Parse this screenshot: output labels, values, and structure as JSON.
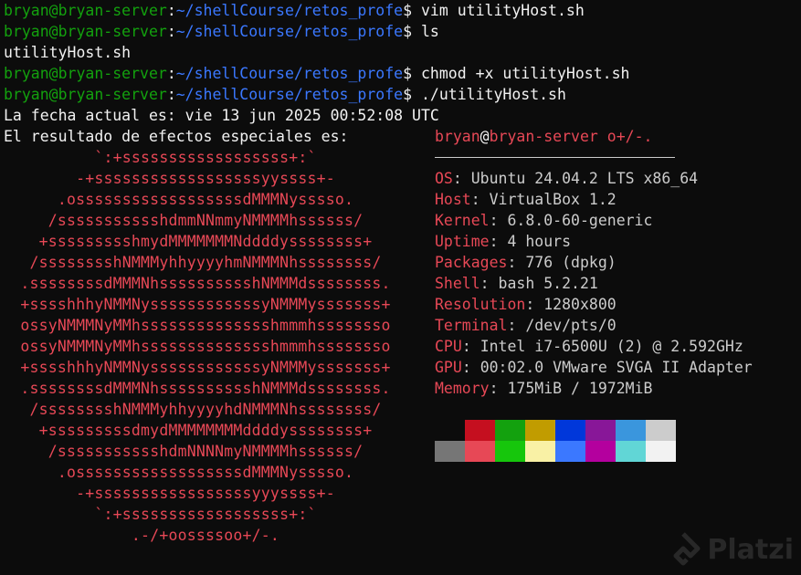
{
  "window": {
    "title": ""
  },
  "prompt": {
    "user": "bryan@bryan-server",
    "path": "~/shellCourse/retos_profe",
    "symbol": "$"
  },
  "commands": [
    "vim utilityHost.sh",
    "ls",
    "chmod +x utilityHost.sh",
    "./utilityHost.sh"
  ],
  "ls_output": "utilityHost.sh",
  "date_line": "La fecha actual es: vie 13 jun 2025 00:52:08 UTC",
  "effects_line": "El resultado de efectos especiales es:",
  "ascii_logo": [
    "`:+ssssssssssssssssss+:`",
    "-+ssssssssssssssssssyyssss+-",
    ".ossssssssssssssssssdMMMNysssso.",
    "/ssssssssssshdmmNNmmyNMMMMhssssss/",
    "+ssssssssshmydMMMMMMMNddddyssssssss+",
    "/sssssssshNMMMyhhyyyyhmNMMMNhssssssss/",
    ".ssssssssdMMMNhsssssssssshNMMMdssssssss.",
    "+sssshhhyNMMNyssssssssssssyNMMMysssssss+",
    "ossyNMMMNyMMhsssssssssssssshmmmhssssssso",
    "ossyNMMMNyMMhsssssssssssssshmmmhssssssso",
    "+sssshhhyNMMNyssssssssssssyNMMMysssssss+",
    ".ssssssssdMMMNhsssssssssshNMMMdssssssss.",
    "/sssssssshNMMMyhhyyyyhdNMMMNhssssssss/",
    "+sssssssssdmydMMMMMMMMddddyssssssss+",
    "/ssssssssssshdmNNNNmyNMMMMhssssss/",
    ".ossssssssssssssssssdMMMNysssso.",
    "-+sssssssssssssssssyyyssss+-",
    "`:+ssssssssssssssssss+:`",
    ".-/+oossssoo+/-."
  ],
  "sysinfo": {
    "header_user": "bryan",
    "header_at": "@",
    "header_host": "bryan-server",
    "header_suffix": " o+/-.",
    "rows": [
      {
        "key": "OS",
        "value": "Ubuntu 24.04.2 LTS x86_64"
      },
      {
        "key": "Host",
        "value": "VirtualBox 1.2"
      },
      {
        "key": "Kernel",
        "value": "6.8.0-60-generic"
      },
      {
        "key": "Uptime",
        "value": "4 hours"
      },
      {
        "key": "Packages",
        "value": "776 (dpkg)"
      },
      {
        "key": "Shell",
        "value": "bash 5.2.21"
      },
      {
        "key": "Resolution",
        "value": "1280x800"
      },
      {
        "key": "Terminal",
        "value": "/dev/pts/0"
      },
      {
        "key": "CPU",
        "value": "Intel i7-6500U (2) @ 2.592GHz"
      },
      {
        "key": "GPU",
        "value": "00:02.0 VMware SVGA II Adapter"
      },
      {
        "key": "Memory",
        "value": "175MiB / 1972MiB"
      }
    ],
    "separator": ":"
  },
  "palette_colors": [
    "#0c0c0c",
    "#c50f1f",
    "#13a10e",
    "#c19c00",
    "#0037da",
    "#881798",
    "#3a96dd",
    "#cccccc",
    "#767676",
    "#e74856",
    "#16c60c",
    "#f9f1a5",
    "#3b78ff",
    "#b4009e",
    "#61d6d6",
    "#f2f2f2"
  ],
  "watermark": {
    "text": "Platzi",
    "icon": "platzi-logo-icon"
  }
}
